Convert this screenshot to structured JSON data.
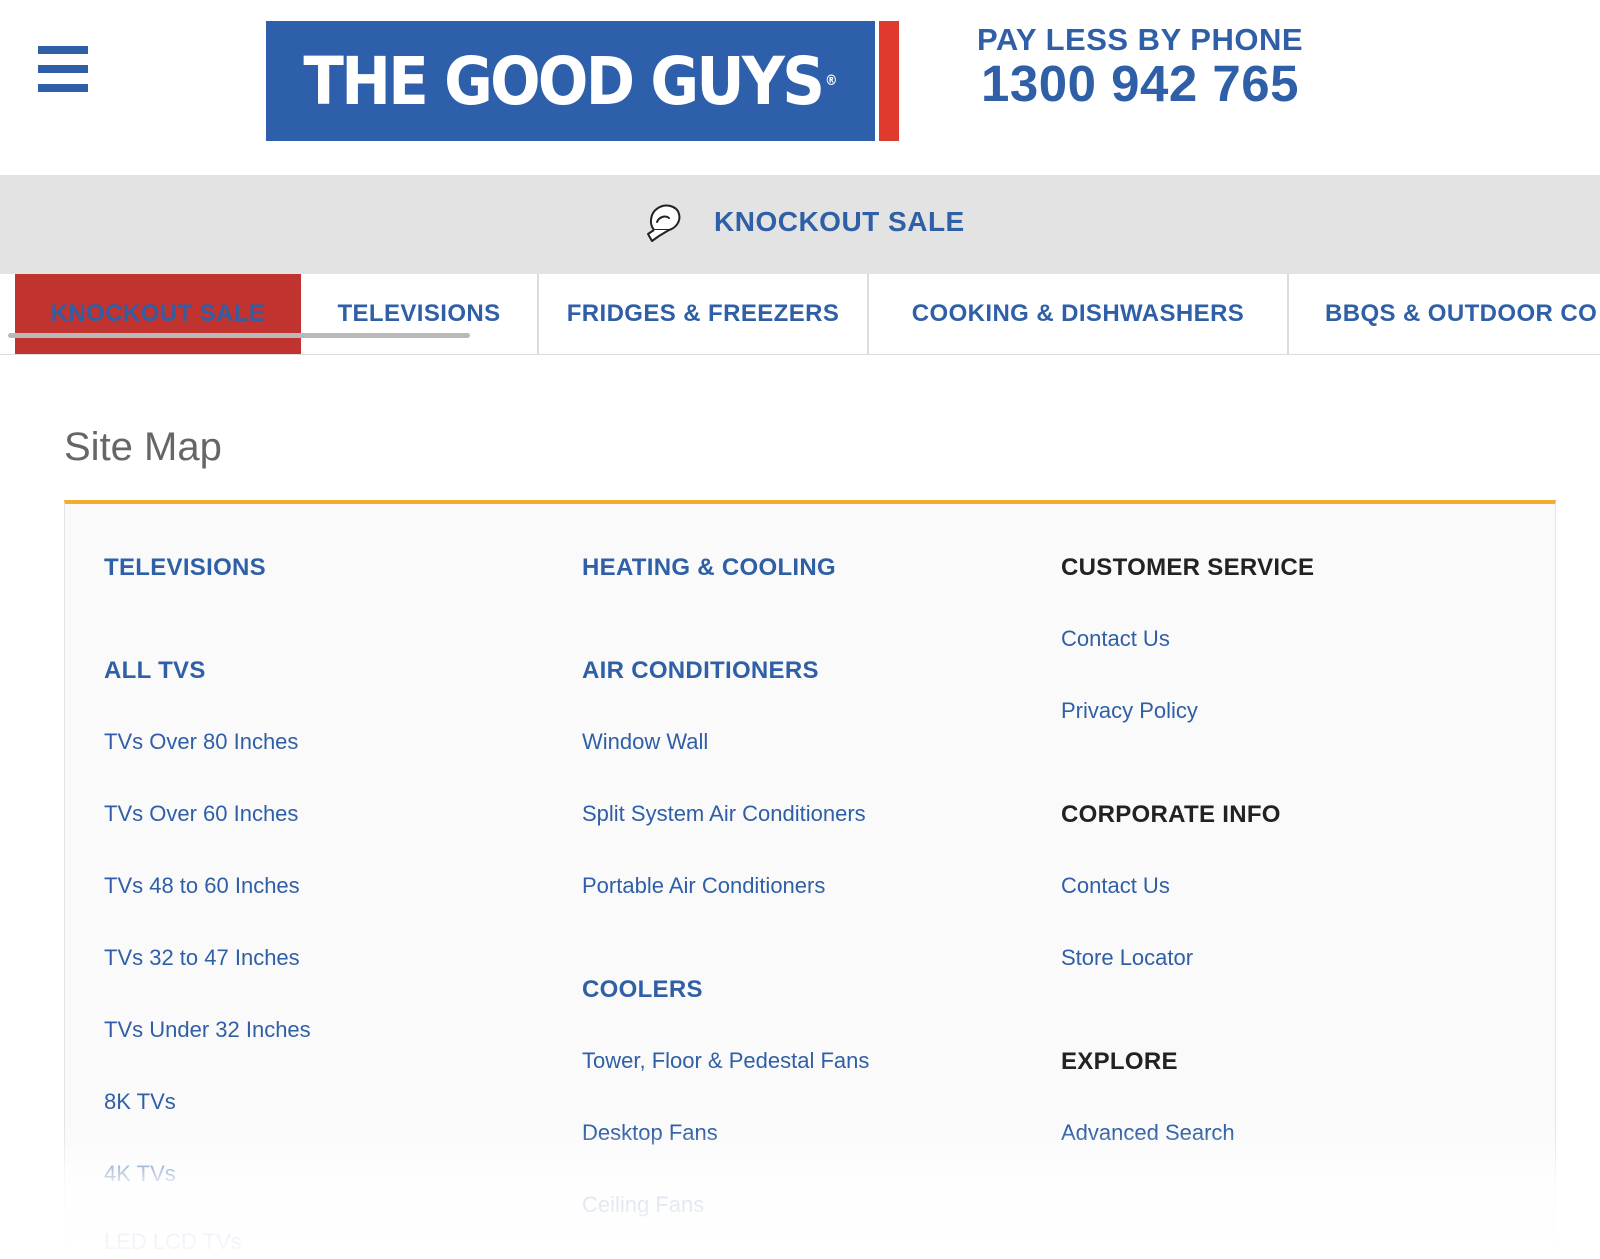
{
  "header": {
    "menu_icon": "hamburger-menu-icon",
    "logo_text": "THE GOOD GUYS",
    "logo_mark": "®",
    "phone_label": "PAY LESS BY PHONE",
    "phone_number": "1300 942 765",
    "colors": {
      "brand_blue": "#2e5fab",
      "brand_red": "#e03a2f"
    }
  },
  "promo": {
    "icon": "boxing-glove-icon",
    "label": "KNOCKOUT SALE"
  },
  "tabs": [
    {
      "label": "KNOCKOUT SALE",
      "active": true
    },
    {
      "label": "TELEVISIONS"
    },
    {
      "label": "FRIDGES & FREEZERS"
    },
    {
      "label": "COOKING & DISHWASHERS"
    },
    {
      "label": "BBQS & OUTDOOR CO"
    }
  ],
  "sitemap": {
    "title": "Site Map",
    "accent_color": "#f2ad2f",
    "col1": {
      "heading": "TELEVISIONS",
      "subheading": "ALL TVS",
      "links": [
        "TVs Over 80 Inches",
        "TVs Over 60 Inches",
        "TVs 48 to 60 Inches",
        "TVs 32 to 47 Inches",
        "TVs Under 32 Inches",
        "8K TVs",
        "4K TVs",
        "LED LCD TVs"
      ]
    },
    "col2": {
      "heading": "HEATING & COOLING",
      "sections": [
        {
          "heading": "AIR CONDITIONERS",
          "links": [
            "Window Wall",
            "Split System Air Conditioners",
            "Portable Air Conditioners"
          ]
        },
        {
          "heading": "COOLERS",
          "links": [
            "Tower, Floor & Pedestal Fans",
            "Desktop Fans",
            "Ceiling Fans"
          ]
        }
      ]
    },
    "col3": {
      "sections": [
        {
          "heading": "CUSTOMER SERVICE",
          "links": [
            "Contact Us",
            "Privacy Policy"
          ]
        },
        {
          "heading": "CORPORATE INFO",
          "links": [
            "Contact Us",
            "Store Locator"
          ]
        },
        {
          "heading": "EXPLORE",
          "links": [
            "Advanced Search"
          ]
        }
      ]
    }
  }
}
